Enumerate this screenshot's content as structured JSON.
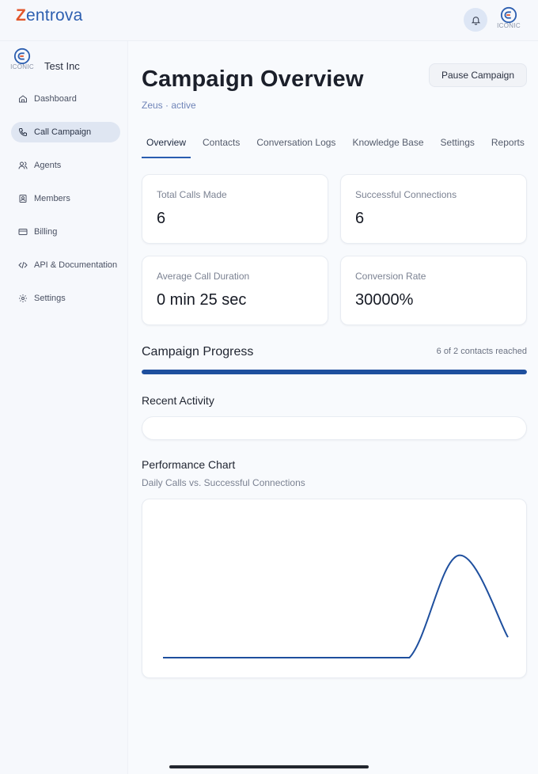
{
  "app": {
    "brand_first": "Z",
    "brand_rest": "entrova"
  },
  "org": {
    "name": "Test Inc",
    "logo_text": "ICONIC"
  },
  "sidebar": {
    "items": [
      {
        "label": "Dashboard",
        "icon": "home-icon",
        "active": false
      },
      {
        "label": "Call Campaign",
        "icon": "phone-icon",
        "active": true
      },
      {
        "label": "Agents",
        "icon": "users-icon",
        "active": false
      },
      {
        "label": "Members",
        "icon": "id-card-icon",
        "active": false
      },
      {
        "label": "Billing",
        "icon": "credit-card-icon",
        "active": false
      },
      {
        "label": "API & Documentation",
        "icon": "code-icon",
        "active": false
      },
      {
        "label": "Settings",
        "icon": "gear-icon",
        "active": false
      }
    ]
  },
  "header": {
    "title": "Campaign Overview",
    "subtitle": "Zeus · active",
    "pause_label": "Pause Campaign"
  },
  "tabs": [
    {
      "label": "Overview",
      "active": true
    },
    {
      "label": "Contacts",
      "active": false
    },
    {
      "label": "Conversation Logs",
      "active": false
    },
    {
      "label": "Knowledge Base",
      "active": false
    },
    {
      "label": "Settings",
      "active": false
    },
    {
      "label": "Reports",
      "active": false
    }
  ],
  "stats": {
    "total_calls": {
      "label": "Total Calls Made",
      "value": "6"
    },
    "successful": {
      "label": "Successful Connections",
      "value": "6"
    },
    "avg_duration": {
      "label": "Average Call Duration",
      "value": "0 min 25 sec"
    },
    "conversion": {
      "label": "Conversion Rate",
      "value": "30000%"
    }
  },
  "progress": {
    "title": "Campaign Progress",
    "meta": "6 of 2 contacts reached",
    "fraction": 1.0
  },
  "recent_activity": {
    "title": "Recent Activity"
  },
  "performance": {
    "title": "Performance Chart",
    "subtitle": "Daily Calls vs. Successful Connections"
  },
  "colors": {
    "accent": "#2a5db0",
    "progress": "#1e4f9e",
    "line": "#1e4f9e",
    "brand_z": "#e2562b"
  },
  "chart_data": {
    "type": "line",
    "title": "",
    "xlabel": "",
    "ylabel": "",
    "grid": false,
    "legend": "none",
    "x": [
      0,
      1,
      2,
      3,
      4,
      5,
      6,
      7
    ],
    "series": [
      {
        "values": [
          0,
          0,
          0,
          0,
          0,
          0,
          6,
          1.2
        ]
      }
    ],
    "ylim": [
      0,
      6.5
    ]
  }
}
